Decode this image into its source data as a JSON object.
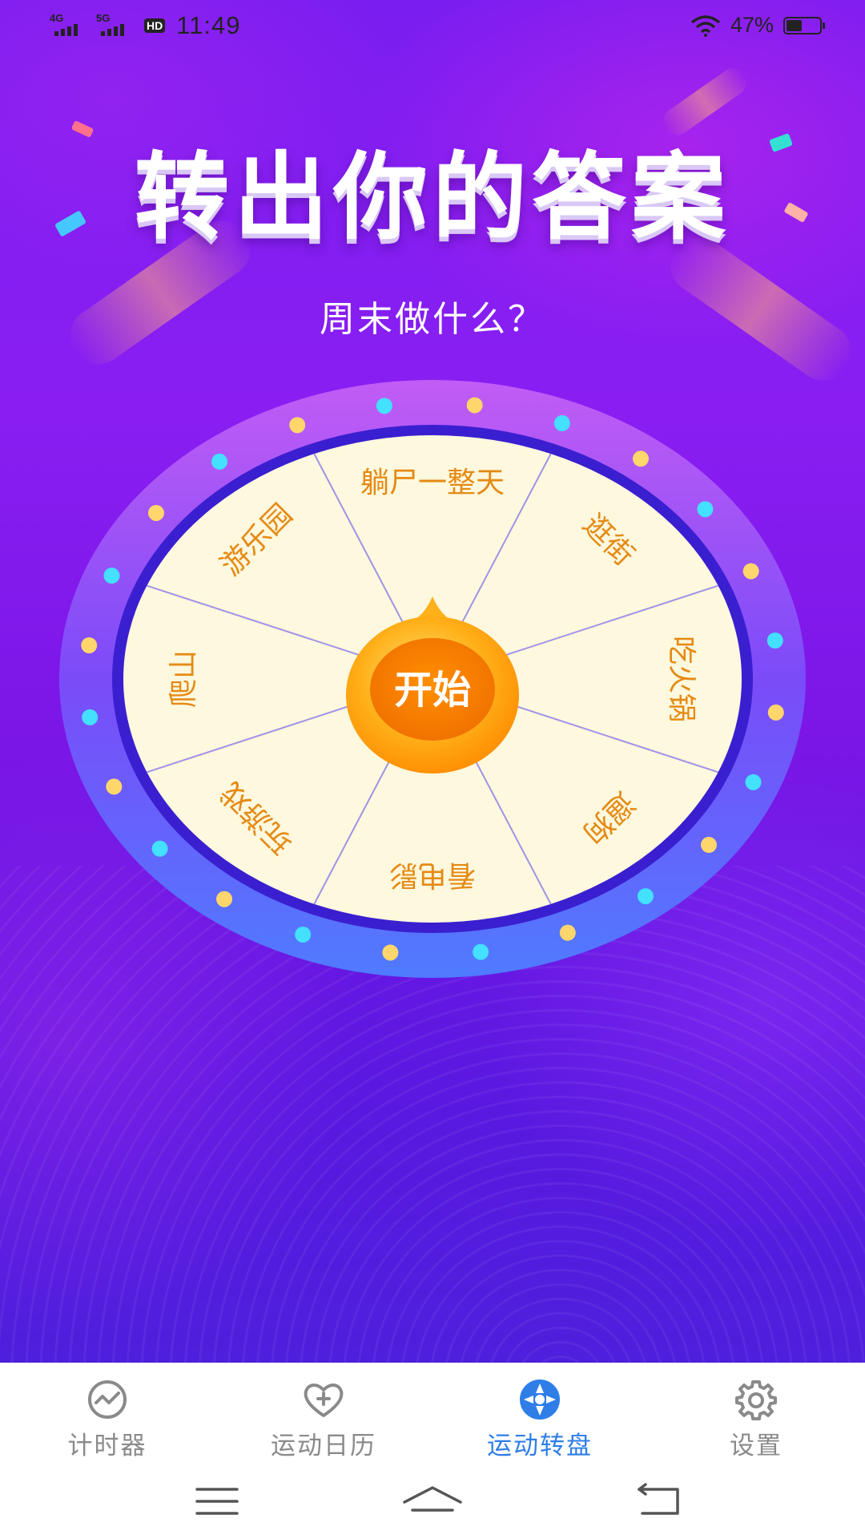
{
  "status_bar": {
    "network1": "4G",
    "network2": "5G",
    "hd": "HD",
    "time": "11:49",
    "battery": "47%",
    "battery_level": 0.47
  },
  "header": {
    "title": "转出你的答案",
    "question": "周末做什么？"
  },
  "wheel": {
    "start_label": "开始",
    "segments": [
      "躺尸一整天",
      "逛街",
      "吃火锅",
      "遛狗",
      "看电影",
      "玩游戏",
      "爬山",
      "游乐园"
    ],
    "colors": {
      "segment_fill": "#fdf8de",
      "segment_text": "#e58a14",
      "rim": "#7c4dfa",
      "inner_ring": "#3a1fd0",
      "dot_gold": "#ffd66b",
      "dot_cyan": "#43e0ff",
      "button": "#ff9c12"
    }
  },
  "tabs": [
    {
      "label": "计时器",
      "icon": "chart-circle-icon",
      "active": false
    },
    {
      "label": "运动日历",
      "icon": "heart-plus-icon",
      "active": false
    },
    {
      "label": "运动转盘",
      "icon": "wheel-icon",
      "active": true
    },
    {
      "label": "设置",
      "icon": "gear-icon",
      "active": false
    }
  ],
  "accent_color": "#2f7ee8",
  "inactive_color": "#8a8a8a"
}
